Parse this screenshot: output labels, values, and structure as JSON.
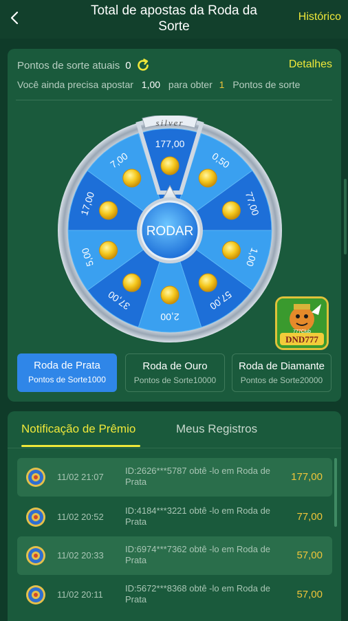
{
  "header": {
    "title": "Total de apostas da Roda da Sorte",
    "history": "Histórico"
  },
  "points": {
    "label": "Pontos de sorte atuais",
    "value": "0",
    "details": "Detalhes",
    "need_prefix": "Você ainda precisa apostar",
    "need_amount": "1,00",
    "need_mid": "para obter",
    "need_points": "1",
    "need_suffix": "Pontos de sorte"
  },
  "wheel": {
    "badge": "silver",
    "spin_label": "RODAR",
    "segments": [
      "177,00",
      "0,50",
      "77,00",
      "1,00",
      "57,00",
      "2,00",
      "37,00",
      "5,00",
      "17,00",
      "7,00"
    ]
  },
  "logo": {
    "text": "DND777",
    "subtext": "777Club"
  },
  "wheel_tabs": [
    {
      "title": "Roda de Prata",
      "subtitle": "Pontos de Sorte1000",
      "active": true
    },
    {
      "title": "Roda de Ouro",
      "subtitle": "Pontos de Sorte10000",
      "active": false
    },
    {
      "title": "Roda de Diamante",
      "subtitle": "Pontos de Sorte20000",
      "active": false
    }
  ],
  "panel_tabs": {
    "notifications": "Notificação de Prêmio",
    "records": "Meus Registros"
  },
  "records": [
    {
      "time": "11/02 21:07",
      "desc": "ID:2626***5787 obtê -lo em Roda de Prata",
      "amount": "177,00"
    },
    {
      "time": "11/02 20:52",
      "desc": "ID:4184***3221 obtê -lo em Roda de Prata",
      "amount": "77,00"
    },
    {
      "time": "11/02 20:33",
      "desc": "ID:6974***7362 obtê -lo em Roda de Prata",
      "amount": "57,00"
    },
    {
      "time": "11/02 20:11",
      "desc": "ID:5672***8368 obtê -lo em Roda de Prata",
      "amount": "57,00"
    }
  ],
  "colors": {
    "accent_yellow": "#f0e83a",
    "amount_gold": "#f0c53a",
    "active_blue": "#2f86e8",
    "wheel_dark": "#1d6fd8",
    "wheel_light": "#3aa0f0"
  }
}
